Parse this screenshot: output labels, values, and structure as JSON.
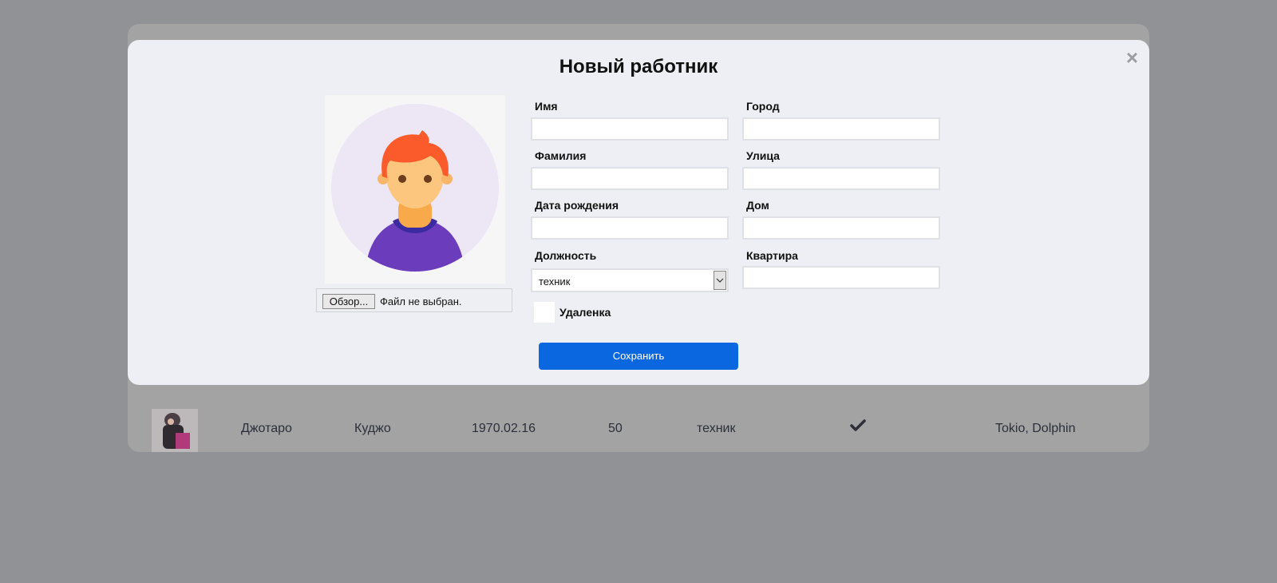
{
  "background_table": {
    "row": {
      "first_name": "Джотаро",
      "last_name": "Куджо",
      "birth_date": "1970.02.16",
      "age": "50",
      "position": "техник",
      "address": "Tokio, Dolphin"
    }
  },
  "modal": {
    "title": "Новый работник",
    "close_glyph": "×",
    "file": {
      "browse_label": "Обзор...",
      "status": "Файл не выбран."
    },
    "fields": {
      "first_name": {
        "label": "Имя",
        "value": ""
      },
      "last_name": {
        "label": "Фамилия",
        "value": ""
      },
      "birth_date": {
        "label": "Дата рождения",
        "value": ""
      },
      "position": {
        "label": "Должность",
        "value": "техник"
      },
      "city": {
        "label": "Город",
        "value": ""
      },
      "street": {
        "label": "Улица",
        "value": ""
      },
      "house": {
        "label": "Дом",
        "value": ""
      },
      "apartment": {
        "label": "Квартира",
        "value": ""
      }
    },
    "remote": {
      "label": "Удаленка",
      "checked": false
    },
    "save_label": "Сохранить"
  },
  "colors": {
    "overlay": "#919296",
    "modal_bg": "#eeeff4",
    "primary_button": "#0a67e0",
    "avatar_shirt": "#6b3dbd",
    "avatar_hair": "#fb5a2a"
  }
}
